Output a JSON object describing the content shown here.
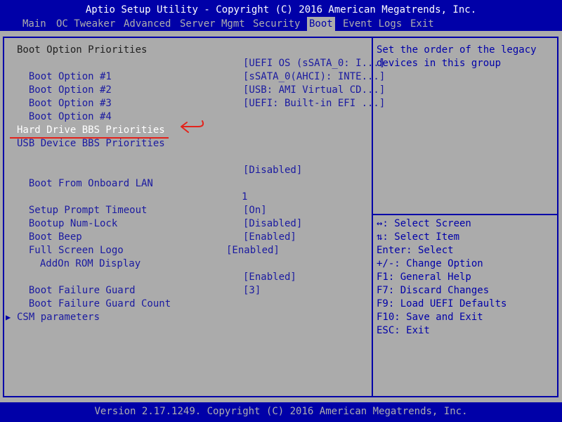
{
  "header": {
    "title": "Aptio Setup Utility - Copyright (C) 2016 American Megatrends, Inc."
  },
  "tabs": [
    {
      "label": "Main"
    },
    {
      "label": "OC Tweaker"
    },
    {
      "label": "Advanced"
    },
    {
      "label": "Server Mgmt"
    },
    {
      "label": "Security"
    },
    {
      "label": "Boot",
      "active": true
    },
    {
      "label": "Event Logs"
    },
    {
      "label": "Exit"
    }
  ],
  "main": {
    "section_title": "Boot Option Priorities",
    "boot_options": [
      {
        "label": "Boot Option #1",
        "value": "[UEFI OS (sSATA_0: I...]"
      },
      {
        "label": "Boot Option #2",
        "value": "[sSATA_0(AHCI): INTE...]"
      },
      {
        "label": "Boot Option #3",
        "value": "[USB: AMI Virtual CD...]"
      },
      {
        "label": "Boot Option #4",
        "value": "[UEFI: Built-in EFI ...]"
      }
    ],
    "hdd_bbs": "Hard Drive BBS Priorities",
    "usb_bbs": "USB Device BBS Priorities",
    "onboard_lan": {
      "label": "Boot From Onboard LAN",
      "value": "[Disabled]"
    },
    "prompt_timeout": {
      "label": "Setup Prompt Timeout",
      "value": "1"
    },
    "numlock": {
      "label": "Bootup Num-Lock",
      "value": "[On]"
    },
    "boot_beep": {
      "label": "Boot Beep",
      "value": "[Disabled]"
    },
    "full_logo": {
      "label": "Full Screen Logo",
      "value": "[Enabled]"
    },
    "addon_rom": {
      "label": "AddOn ROM Display",
      "value": "[Enabled]"
    },
    "failure_guard": {
      "label": "Boot Failure Guard",
      "value": "[Enabled]"
    },
    "failure_count": {
      "label": "Boot Failure Guard Count",
      "value": "[3]"
    },
    "csm": "CSM parameters"
  },
  "help": {
    "text": "Set the order of the legacy devices in this group"
  },
  "keys": [
    {
      "text": "↔: Select Screen"
    },
    {
      "text": "⇅: Select Item"
    },
    {
      "text": "Enter: Select"
    },
    {
      "text": "+/-: Change Option"
    },
    {
      "text": "F1: General Help"
    },
    {
      "text": "F7: Discard Changes"
    },
    {
      "text": "F9: Load UEFI Defaults"
    },
    {
      "text": "F10: Save and Exit"
    },
    {
      "text": "ESC: Exit"
    }
  ],
  "footer": {
    "text": "Version 2.17.1249. Copyright (C) 2016 American Megatrends, Inc."
  },
  "icons": {
    "submenu": "triangle-right-icon",
    "annotation": "hand-drawn-arrow-icon"
  },
  "colors": {
    "header_bg": "#0000a8",
    "panel_bg": "#ababab",
    "item_text": "#1a1aa0",
    "selected_text": "#ffffff",
    "annotation": "#e3231b"
  }
}
